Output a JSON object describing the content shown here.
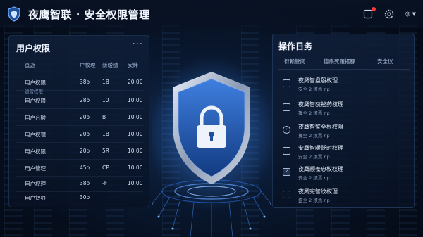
{
  "app": {
    "title": "夜鹰智联 · 安全权限管理"
  },
  "header": {
    "icons": [
      "notification-icon",
      "settings-icon",
      "user-settings-icon"
    ]
  },
  "permissions": {
    "title": "用户权限",
    "more": "···",
    "columns": [
      "直逝",
      "户校理",
      "新暧缱",
      "安绊"
    ],
    "rows": [
      {
        "name": "用户权限",
        "sub": "运营权限",
        "a": "38o",
        "b": "1B",
        "c": "20.00"
      },
      {
        "name": "用户权限",
        "sub": "",
        "a": "28o",
        "b": "10",
        "c": "10.00"
      },
      {
        "name": "用户台酸",
        "sub": "",
        "a": "20o",
        "b": "B",
        "c": "10.00"
      },
      {
        "name": "用户权理",
        "sub": "",
        "a": "20o",
        "b": "1B",
        "c": "10.00"
      },
      {
        "name": "用户权限",
        "sub": "",
        "a": "20o",
        "b": "5R",
        "c": "10.00"
      },
      {
        "name": "用户管理",
        "sub": "",
        "a": "45o",
        "b": "CP",
        "c": "10.00"
      },
      {
        "name": "用户权理",
        "sub": "",
        "a": "38o",
        "b": "-F",
        "c": "10.00"
      },
      {
        "name": "用户智狠",
        "sub": "",
        "a": "30o",
        "b": "",
        "c": ""
      }
    ]
  },
  "tasks": {
    "title": "操作日务",
    "tabs": [
      "衍赖管阆",
      "德扇死雁撂豚",
      "安全议"
    ],
    "items": [
      {
        "name": "夜鹰智盘殷权理",
        "sub": "安全 2 须焉 np",
        "state": "unchecked"
      },
      {
        "name": "夜鹰智获祕药权理",
        "sub": "操全 2 须焉 np",
        "state": "unchecked"
      },
      {
        "name": "夜鹰智譬全根权限",
        "sub": "操全 2 须焉 np",
        "state": "radio"
      },
      {
        "name": "安鹰智暖贬时权理",
        "sub": "安全 2 须焉 np",
        "state": "unchecked"
      },
      {
        "name": "夜鹰颛養忠权权理",
        "sub": "安全 2 须焉 np",
        "state": "checked"
      },
      {
        "name": "夜鹰宪智纹权理",
        "sub": "盛全 2 须焉 np",
        "state": "unchecked"
      }
    ]
  },
  "colors": {
    "accent": "#3b8cff",
    "bg": "#060e1d",
    "shield": "#2b66c9"
  }
}
